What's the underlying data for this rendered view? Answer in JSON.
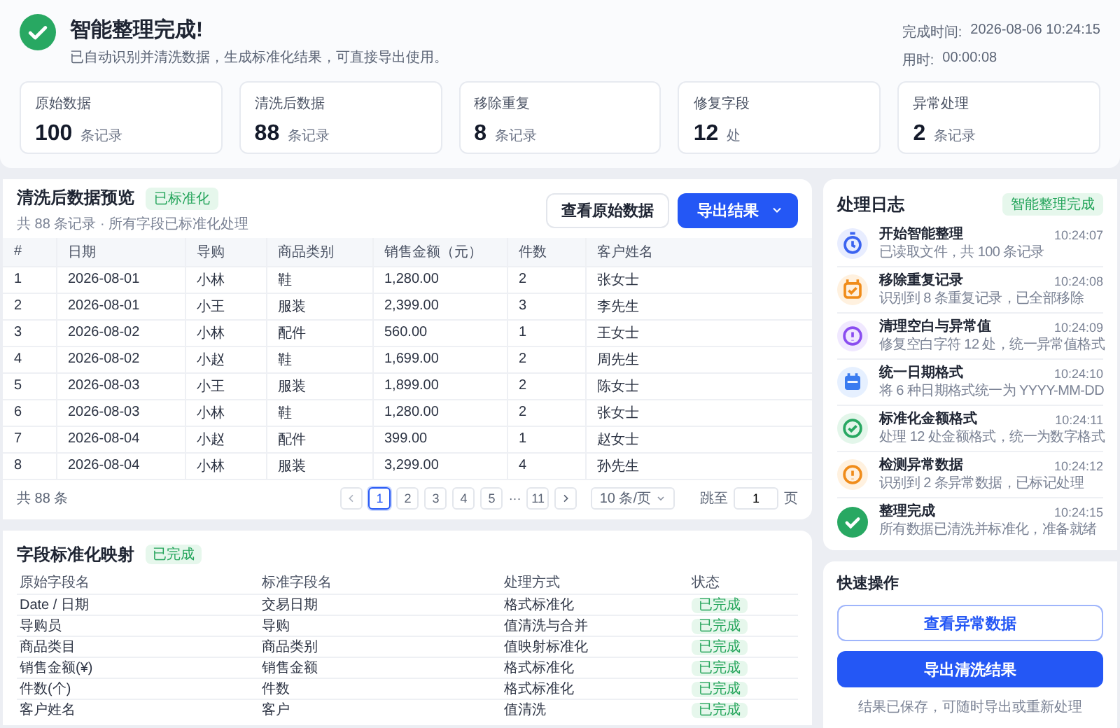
{
  "header": {
    "title": "智能整理完成!",
    "subtitle": "已自动识别并清洗数据，生成标准化结果，可直接导出使用。",
    "meta": [
      {
        "label": "完成时间:",
        "value": "2026-08-06 10:24:15"
      },
      {
        "label": "用时:",
        "value": "00:00:08"
      }
    ],
    "stats": [
      {
        "label": "原始数据",
        "value": "100",
        "unit": "条记录"
      },
      {
        "label": "清洗后数据",
        "value": "88",
        "unit": "条记录"
      },
      {
        "label": "移除重复",
        "value": "8",
        "unit": "条记录"
      },
      {
        "label": "修复字段",
        "value": "12",
        "unit": "处"
      },
      {
        "label": "异常处理",
        "value": "2",
        "unit": "条记录"
      }
    ]
  },
  "preview": {
    "title": "清洗后数据预览",
    "badge": "已标准化",
    "subtitle": "共 88 条记录 · 所有字段已标准化处理",
    "view_raw_button": "查看原始数据",
    "export_button": "导出结果",
    "columns": [
      "#",
      "日期",
      "导购",
      "商品类别",
      "销售金额（元）",
      "件数",
      "客户姓名"
    ],
    "rows": [
      [
        "1",
        "2026-08-01",
        "小林",
        "鞋",
        "1,280.00",
        "2",
        "张女士"
      ],
      [
        "2",
        "2026-08-01",
        "小王",
        "服装",
        "2,399.00",
        "3",
        "李先生"
      ],
      [
        "3",
        "2026-08-02",
        "小林",
        "配件",
        "560.00",
        "1",
        "王女士"
      ],
      [
        "4",
        "2026-08-02",
        "小赵",
        "鞋",
        "1,699.00",
        "2",
        "周先生"
      ],
      [
        "5",
        "2026-08-03",
        "小王",
        "服装",
        "1,899.00",
        "2",
        "陈女士"
      ],
      [
        "6",
        "2026-08-03",
        "小林",
        "鞋",
        "1,280.00",
        "2",
        "张女士"
      ],
      [
        "7",
        "2026-08-04",
        "小赵",
        "配件",
        "399.00",
        "1",
        "赵女士"
      ],
      [
        "8",
        "2026-08-04",
        "小林",
        "服装",
        "3,299.00",
        "4",
        "孙先生"
      ]
    ],
    "pagination": {
      "total": "共 88 条",
      "pages": [
        {
          "label": "1",
          "selected": true
        },
        {
          "label": "2",
          "selected": false
        },
        {
          "label": "3",
          "selected": false
        },
        {
          "label": "4",
          "selected": false
        },
        {
          "label": "5",
          "selected": false
        }
      ],
      "ellipsis": "···",
      "last_page": {
        "label": "11",
        "selected": false
      },
      "page_size": "10 条/页",
      "jump_label": "跳至",
      "jump_value": "1",
      "jump_unit": "页"
    }
  },
  "mapping": {
    "title": "字段标准化映射",
    "badge": "已完成",
    "columns": [
      "原始字段名",
      "标准字段名",
      "处理方式",
      "状态"
    ],
    "rows": [
      {
        "original": "Date / 日期",
        "standard": "交易日期",
        "method": "格式标准化",
        "status": "已完成"
      },
      {
        "original": "导购员",
        "standard": "导购",
        "method": "值清洗与合并",
        "status": "已完成"
      },
      {
        "original": "商品类目",
        "standard": "商品类别",
        "method": "值映射标准化",
        "status": "已完成"
      },
      {
        "original": "销售金额(¥)",
        "standard": "销售金额",
        "method": "格式标准化",
        "status": "已完成"
      },
      {
        "original": "件数(个)",
        "standard": "件数",
        "method": "格式标准化",
        "status": "已完成"
      },
      {
        "original": "客户姓名",
        "standard": "客户",
        "method": "值清洗",
        "status": "已完成"
      }
    ]
  },
  "log": {
    "title": "处理日志",
    "badge": "智能整理完成",
    "items": [
      {
        "kind": "start",
        "title": "开始智能整理",
        "detail": "已读取文件，共 100 条记录",
        "time": "10:24:07"
      },
      {
        "kind": "duplicate",
        "title": "移除重复记录",
        "detail": "识别到 8 条重复记录，已全部移除",
        "time": "10:24:08"
      },
      {
        "kind": "cleanup",
        "title": "清理空白与异常值",
        "detail": "修复空白字符 12 处，统一异常值格式",
        "time": "10:24:09"
      },
      {
        "kind": "date",
        "title": "统一日期格式",
        "detail": "将 6 种日期格式统一为 YYYY-MM-DD",
        "time": "10:24:10"
      },
      {
        "kind": "amount",
        "title": "标准化金额格式",
        "detail": "处理 12 处金额格式，统一为数字格式",
        "time": "10:24:11"
      },
      {
        "kind": "anomaly",
        "title": "检测异常数据",
        "detail": "识别到 2 条异常数据，已标记处理",
        "time": "10:24:12"
      },
      {
        "kind": "done",
        "title": "整理完成",
        "detail": "所有数据已清洗并标准化，准备就绪",
        "time": "10:24:15"
      }
    ]
  },
  "quick": {
    "title": "快速操作",
    "buttons": [
      {
        "kind": "outline",
        "label": "查看异常数据"
      },
      {
        "kind": "primary",
        "label": "导出清洗结果"
      }
    ],
    "note": "结果已保存，可随时导出或重新处理"
  }
}
